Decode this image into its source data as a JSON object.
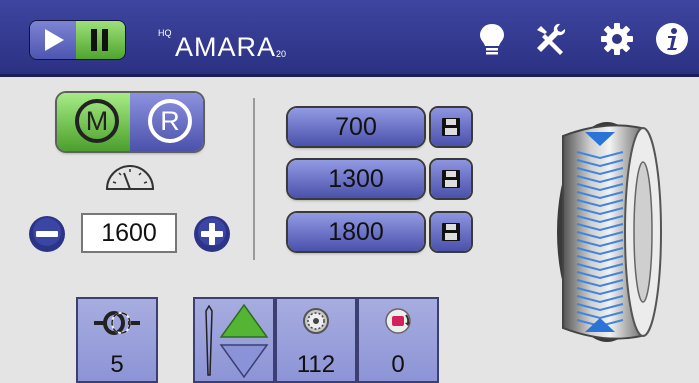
{
  "header": {
    "logo_prefix": "HQ",
    "logo_text": "AMARA",
    "logo_suffix": "20",
    "icons": [
      "play-icon",
      "pause-icon",
      "lightbulb-icon",
      "tools-icon",
      "gear-icon",
      "info-icon"
    ]
  },
  "mode": {
    "manual_label": "M",
    "regulated_label": "R",
    "selected": "M"
  },
  "speed": {
    "value": "1600"
  },
  "presets": [
    {
      "value": "700"
    },
    {
      "value": "1300"
    },
    {
      "value": "1800"
    }
  ],
  "bottom": {
    "tie_off_count": "5",
    "bobbin_count": "112",
    "spool_count": "0"
  },
  "colors": {
    "accent_blue": "#4b52ac",
    "active_green": "#4c9f2c",
    "header_bg": "#2f3588"
  }
}
